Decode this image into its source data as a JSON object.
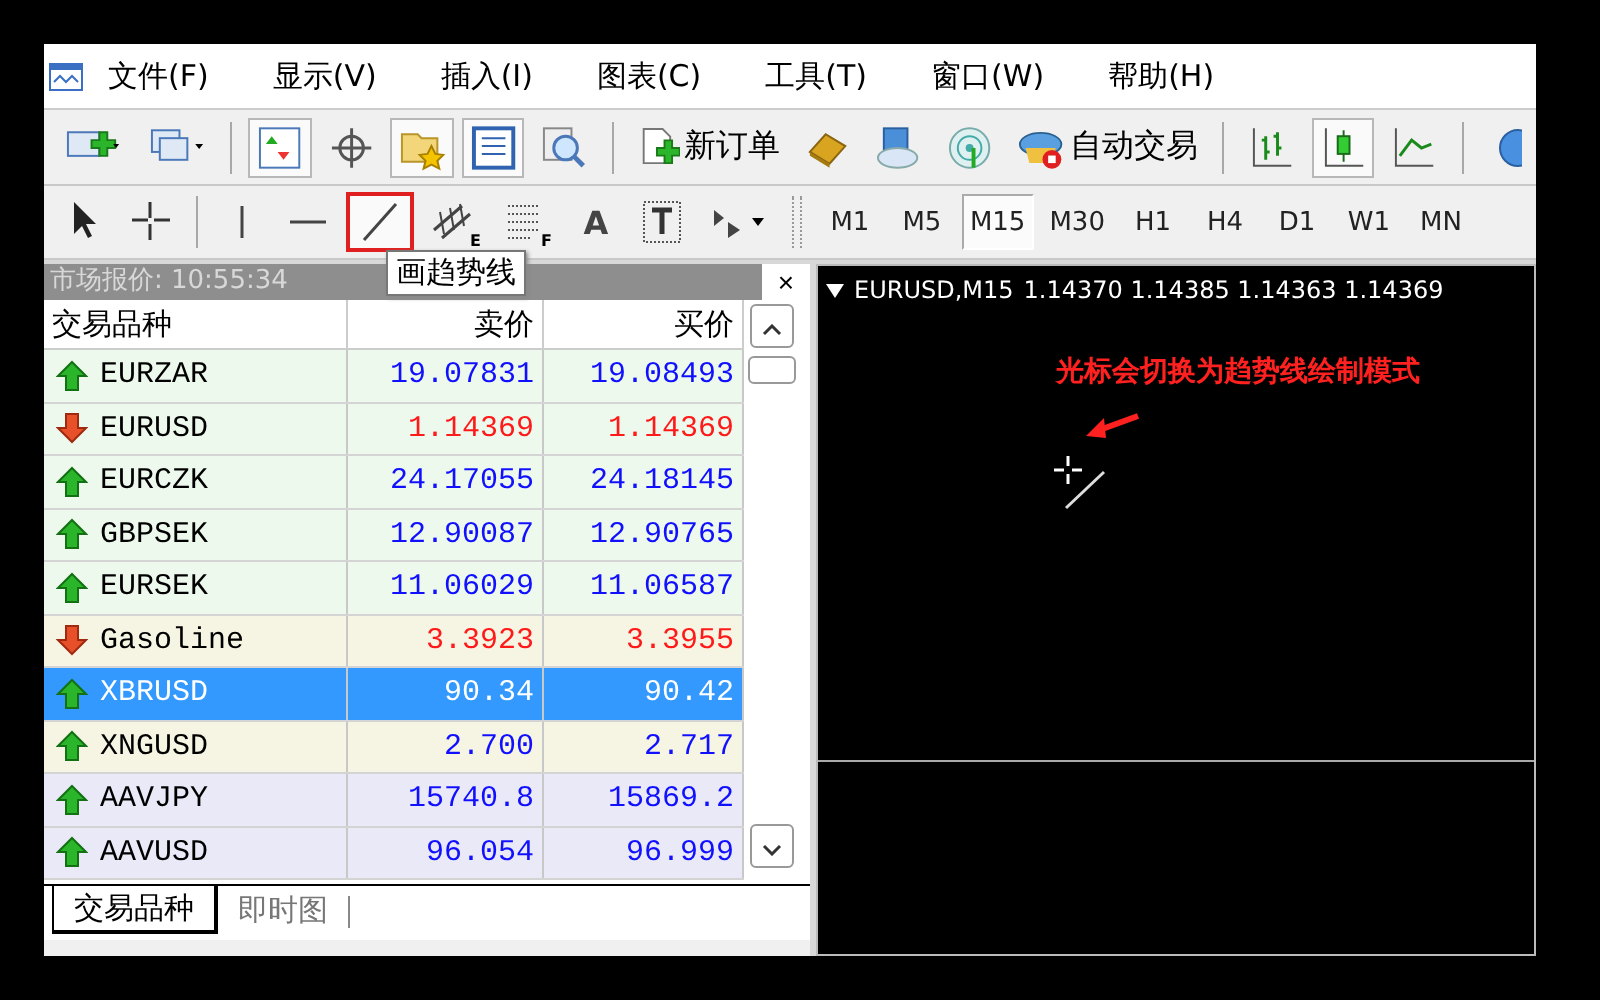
{
  "menu": [
    {
      "label": "文件(F)"
    },
    {
      "label": "显示(V)"
    },
    {
      "label": "插入(I)"
    },
    {
      "label": "图表(C)"
    },
    {
      "label": "工具(T)"
    },
    {
      "label": "窗口(W)"
    },
    {
      "label": "帮助(H)"
    }
  ],
  "toolbar_main": [
    {
      "kind": "icon",
      "pressed": false
    },
    {
      "kind": "icon",
      "pressed": false
    },
    {
      "kind": "separator"
    },
    {
      "kind": "icon",
      "pressed": true
    },
    {
      "kind": "icon",
      "pressed": false
    },
    {
      "kind": "icon",
      "pressed": true
    },
    {
      "kind": "icon",
      "pressed": true
    },
    {
      "kind": "icon",
      "pressed": false
    },
    {
      "kind": "separator"
    },
    {
      "kind": "labeled",
      "label": "新订单",
      "pressed": false
    },
    {
      "kind": "icon",
      "pressed": false
    },
    {
      "kind": "icon",
      "pressed": false
    },
    {
      "kind": "icon",
      "pressed": false
    },
    {
      "kind": "labeled",
      "label": "自动交易",
      "pressed": false
    },
    {
      "kind": "separator"
    },
    {
      "kind": "icon",
      "pressed": false
    },
    {
      "kind": "icon",
      "pressed": true
    },
    {
      "kind": "icon",
      "pressed": false
    },
    {
      "kind": "separator"
    },
    {
      "kind": "icon",
      "pressed": false
    }
  ],
  "drawing_tools": [
    {
      "kind": "icon",
      "pressed": false,
      "highlighted": false
    },
    {
      "kind": "icon",
      "pressed": false,
      "highlighted": false
    },
    {
      "kind": "separator"
    },
    {
      "kind": "icon",
      "pressed": false,
      "highlighted": false
    },
    {
      "kind": "icon",
      "pressed": false,
      "highlighted": false
    },
    {
      "kind": "icon",
      "pressed": true,
      "highlighted": true
    },
    {
      "kind": "icon",
      "badge": "E",
      "pressed": false,
      "highlighted": false
    },
    {
      "kind": "icon",
      "badge": "F",
      "pressed": false,
      "highlighted": false
    },
    {
      "kind": "text",
      "label": "A",
      "pressed": false,
      "highlighted": false
    },
    {
      "kind": "icon",
      "pressed": false,
      "highlighted": false
    },
    {
      "kind": "icon",
      "pressed": false,
      "highlighted": false
    }
  ],
  "timeframes": [
    {
      "label": "M1",
      "selected": false
    },
    {
      "label": "M5",
      "selected": false
    },
    {
      "label": "M15",
      "selected": true
    },
    {
      "label": "M30",
      "selected": false
    },
    {
      "label": "H1",
      "selected": false
    },
    {
      "label": "H4",
      "selected": false
    },
    {
      "label": "D1",
      "selected": false
    },
    {
      "label": "W1",
      "selected": false
    },
    {
      "label": "MN",
      "selected": false
    }
  ],
  "tooltip": "画趋势线",
  "market_watch": {
    "title": "市场报价: 10:55:34",
    "close": "×",
    "columns": [
      "交易品种",
      "卖价",
      "买价"
    ],
    "rows": [
      {
        "symbol": "EURZAR",
        "rising": true,
        "bid": "19.07831",
        "ask": "19.08493",
        "color": "#eef9ee",
        "selected": false
      },
      {
        "symbol": "EURUSD",
        "rising": false,
        "bid": "1.14369",
        "ask": "1.14369",
        "color": "#eef9ee",
        "selected": false
      },
      {
        "symbol": "EURCZK",
        "rising": true,
        "bid": "24.17055",
        "ask": "24.18145",
        "color": "#eef9ee",
        "selected": false
      },
      {
        "symbol": "GBPSEK",
        "rising": true,
        "bid": "12.90087",
        "ask": "12.90765",
        "color": "#eef9ee",
        "selected": false
      },
      {
        "symbol": "EURSEK",
        "rising": true,
        "bid": "11.06029",
        "ask": "11.06587",
        "color": "#eef9ee",
        "selected": false
      },
      {
        "symbol": "Gasoline",
        "rising": false,
        "bid": "3.3923",
        "ask": "3.3955",
        "color": "#f6f4e2",
        "selected": false
      },
      {
        "symbol": "XBRUSD",
        "rising": true,
        "bid": "90.34",
        "ask": "90.42",
        "color": "#3399ff",
        "selected": true
      },
      {
        "symbol": "XNGUSD",
        "rising": true,
        "bid": "2.700",
        "ask": "2.717",
        "color": "#f6f4e2",
        "selected": false
      },
      {
        "symbol": "AAVJPY",
        "rising": true,
        "bid": "15740.8",
        "ask": "15869.2",
        "color": "#e9e9f8",
        "selected": false
      },
      {
        "symbol": "AAVUSD",
        "rising": true,
        "bid": "96.054",
        "ask": "96.999",
        "color": "#e9e9f8",
        "selected": false
      }
    ],
    "tabs": [
      {
        "label": "交易品种",
        "selected": true
      },
      {
        "label": "即时图",
        "selected": false
      }
    ]
  },
  "chart": {
    "title": "EURUSD,M15",
    "prices": "1.14370 1.14385 1.14363 1.14369",
    "annotation": "光标会切换为趋势线绘制模式"
  }
}
